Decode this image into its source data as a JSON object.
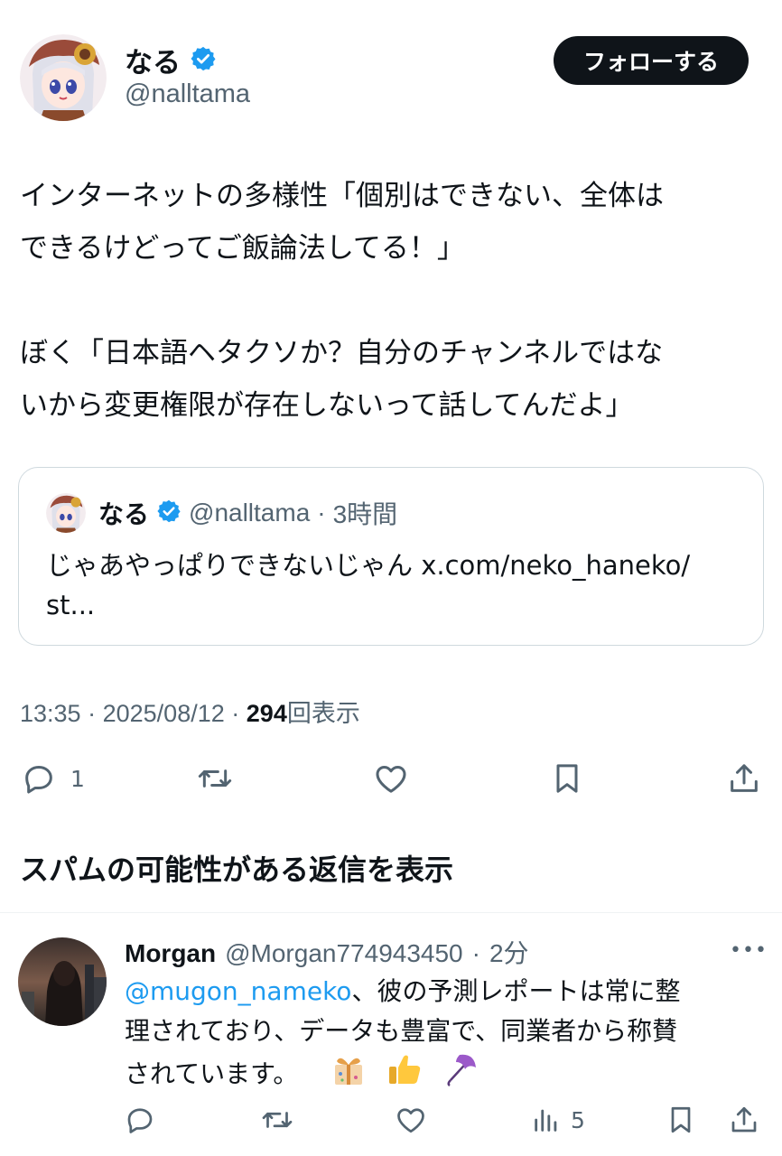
{
  "post": {
    "author": {
      "name": "なる",
      "handle": "@nalltama",
      "verified": true
    },
    "follow_label": "フォローする",
    "text_lines": [
      "インターネットの多様性「個別はできない、全体は",
      "できるけどってご飯論法してる！」",
      "",
      "ぼく「日本語ヘタクソか？自分のチャンネルではな",
      "いから変更権限が存在しないって話してんだよ」"
    ],
    "quote": {
      "name": "なる",
      "handle": "@nalltama",
      "sep": "·",
      "time": "3時間",
      "text_line1": "じゃあやっぱりできないじゃん x.com/neko_haneko/",
      "text_line2": "st..."
    },
    "time": "13:35",
    "date": "2025/08/12",
    "sep": "·",
    "views": "294",
    "views_label": "回表示",
    "actions": {
      "reply_count": "1"
    }
  },
  "spam_replies_label": "スパムの可能性がある返信を表示",
  "reply": {
    "name": "Morgan",
    "handle": "@Morgan774943450",
    "sep": "·",
    "time": "2分",
    "more": "•••",
    "mention": "@mugon_nameko",
    "text_line1": "、彼の予測レポートは常に整",
    "text_line2": "理されており、データも豊富で、同業者から称賛",
    "text_line3": "されています。",
    "emoji_icons": [
      "gift-icon",
      "thumbs-up-icon",
      "umbrella-icon"
    ],
    "views_count": "5"
  },
  "colors": {
    "accent": "#1d9bf0",
    "text": "#0f1419",
    "muted": "#536471",
    "border": "#cfd9de"
  }
}
